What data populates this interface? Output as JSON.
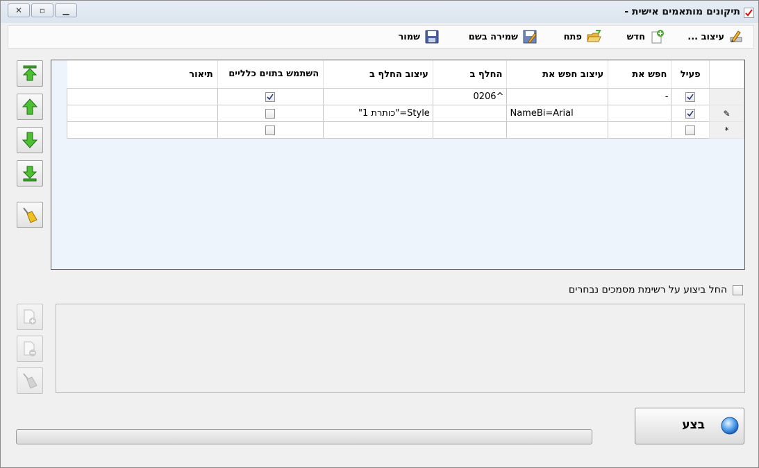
{
  "window": {
    "title": "תיקונים מותאמים אישית -",
    "controls": {
      "minimize": "▁",
      "restore": "▫",
      "close": "✕"
    }
  },
  "toolbar": {
    "design_label": "עיצוב ...",
    "new_label": "חדש",
    "open_label": "פתח",
    "save_as_label": "שמירה בשם",
    "save_label": "שמור"
  },
  "grid": {
    "columns": {
      "active": "פעיל",
      "find": "חפש את",
      "find_format": "עיצוב חפש את",
      "replace": "החלף ב",
      "replace_format": "עיצוב החלף ב",
      "wildcards": "השתמש בתוים כלליים",
      "description": "תיאור"
    },
    "rows": [
      {
        "indicator": "",
        "active": true,
        "find": "-",
        "find_format": "",
        "replace": "^0206",
        "replace_format": "",
        "wildcards": true,
        "description": ""
      },
      {
        "indicator": "✎",
        "active": true,
        "find": "",
        "find_format": "NameBi=Arial",
        "replace": "",
        "replace_format": "Style=\"כותרת 1\"",
        "wildcards": false,
        "description": ""
      },
      {
        "indicator": "*",
        "active": false,
        "find": "",
        "find_format": "",
        "replace": "",
        "replace_format": "",
        "wildcards": false,
        "description": ""
      }
    ]
  },
  "options": {
    "apply_to_selected_docs_label": "החל ביצוע על רשימת מסמכים נבחרים",
    "apply_to_selected_docs_checked": false
  },
  "progress": {
    "value": 0
  },
  "execute": {
    "label": "בצע"
  },
  "colors": {
    "grid_background": "#eef4fc",
    "accent_green": "#3fae2a",
    "window_background": "#f0f0f0"
  }
}
